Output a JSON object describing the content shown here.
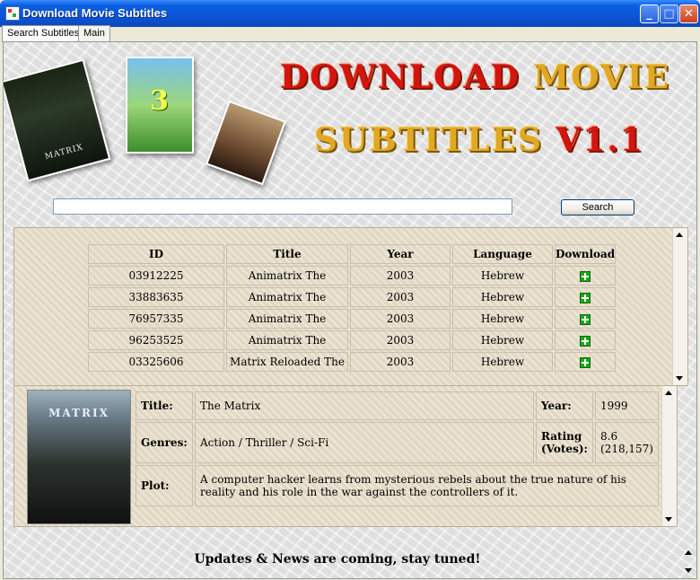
{
  "window": {
    "title": "Download Movie Subtitles",
    "minimize": "_",
    "maximize": "□",
    "close": "✕"
  },
  "tabs": [
    {
      "label": "Search Subtitles",
      "active": true
    },
    {
      "label": "Main",
      "active": false
    }
  ],
  "banner": {
    "logo_line1_a": "DOWNLOAD",
    "logo_line1_b": "MOVIE",
    "logo_line2_a": "SUBTITLES",
    "logo_line2_b": "V1.1",
    "poster1": "MATRIX",
    "poster2": "3"
  },
  "search": {
    "value": "",
    "button_label": "Search"
  },
  "results": {
    "columns": [
      "ID",
      "Title",
      "Year",
      "Language",
      "Download"
    ],
    "rows": [
      {
        "id": "03912225",
        "title": "Animatrix The",
        "year": "2003",
        "language": "Hebrew"
      },
      {
        "id": "33883635",
        "title": "Animatrix The",
        "year": "2003",
        "language": "Hebrew"
      },
      {
        "id": "76957335",
        "title": "Animatrix The",
        "year": "2003",
        "language": "Hebrew"
      },
      {
        "id": "96253525",
        "title": "Animatrix The",
        "year": "2003",
        "language": "Hebrew"
      },
      {
        "id": "03325606",
        "title": "Matrix Reloaded The",
        "year": "2003",
        "language": "Hebrew"
      }
    ]
  },
  "details": {
    "poster_title": "MATRIX",
    "title_label": "Title:",
    "title": "The Matrix",
    "year_label": "Year:",
    "year": "1999",
    "genres_label": "Genres:",
    "genres": "Action / Thriller / Sci-Fi",
    "rating_label": "Rating (Votes):",
    "rating": "8.6 (218,157)",
    "plot_label": "Plot:",
    "plot": "A computer hacker learns from mysterious rebels about the true nature of his reality and his role in the war against the controllers of it."
  },
  "footer": {
    "text": "Updates & News are coming, stay tuned!"
  },
  "colors": {
    "titlebar": "#0a55d8",
    "logo_red": "#d4150f",
    "logo_gold": "#e0a823",
    "download_icon": "#1aa61a"
  }
}
